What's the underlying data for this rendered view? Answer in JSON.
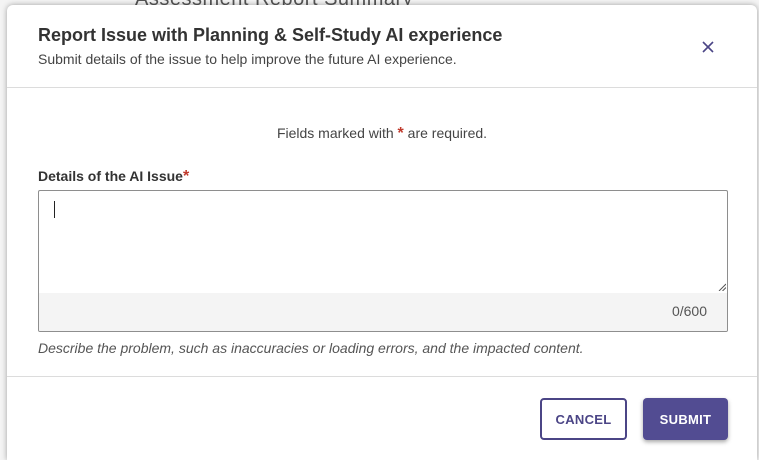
{
  "background": {
    "partial_text": "Assessment Report Summary"
  },
  "modal": {
    "title": "Report Issue with Planning & Self-Study AI experience",
    "subtitle": "Submit details of the issue to help improve the future AI experience.",
    "close_icon": "close-icon",
    "required_note_prefix": "Fields marked with ",
    "required_marker": "*",
    "required_note_suffix": " are required.",
    "field": {
      "label": "Details of the AI Issue",
      "required_marker": "*",
      "value": "",
      "char_count": "0/600",
      "helper": "Describe the problem, such as inaccuracies or loading errors, and the impacted content."
    },
    "buttons": {
      "cancel_label": "CANCEL",
      "submit_label": "SUBMIT"
    }
  },
  "colors": {
    "accent": "#524c92",
    "required": "#c0392b",
    "text": "#333333"
  }
}
